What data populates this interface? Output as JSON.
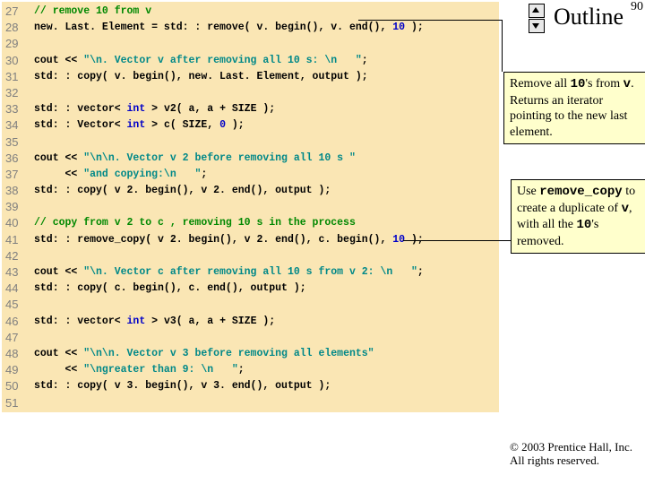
{
  "page_number": "90",
  "outline_label": "Outline",
  "line_start": 27,
  "line_end": 51,
  "code_lines": [
    {
      "n": 27,
      "seg": [
        {
          "c": "cm",
          "t": "// remove 10 from v"
        }
      ]
    },
    {
      "n": 28,
      "seg": [
        {
          "t": "new. Last. Element = std: : remove( v. begin(), v. end(), "
        },
        {
          "c": "kw",
          "t": "10"
        },
        {
          "t": " );"
        }
      ]
    },
    {
      "n": 29,
      "seg": []
    },
    {
      "n": 30,
      "seg": [
        {
          "t": "cout << "
        },
        {
          "c": "str",
          "t": "\"\\n. Vector v after removing all 10 s: \\n   \""
        },
        {
          "t": ";"
        }
      ]
    },
    {
      "n": 31,
      "seg": [
        {
          "t": "std: : copy( v. begin(), new. Last. Element, output );"
        }
      ]
    },
    {
      "n": 32,
      "seg": []
    },
    {
      "n": 33,
      "seg": [
        {
          "t": "std: : vector< "
        },
        {
          "c": "kw",
          "t": "int"
        },
        {
          "t": " > v2( a, a + SIZE );"
        }
      ]
    },
    {
      "n": 34,
      "seg": [
        {
          "t": "std: : Vector< "
        },
        {
          "c": "kw",
          "t": "int"
        },
        {
          "t": " > c( SIZE, "
        },
        {
          "c": "kw",
          "t": "0"
        },
        {
          "t": " );"
        }
      ]
    },
    {
      "n": 35,
      "seg": []
    },
    {
      "n": 36,
      "seg": [
        {
          "t": "cout << "
        },
        {
          "c": "str",
          "t": "\"\\n\\n. Vector v 2 before removing all 10 s \""
        }
      ]
    },
    {
      "n": 37,
      "seg": [
        {
          "t": "     << "
        },
        {
          "c": "str",
          "t": "\"and copying:\\n   \""
        },
        {
          "t": ";"
        }
      ]
    },
    {
      "n": 38,
      "seg": [
        {
          "t": "std: : copy( v 2. begin(), v 2. end(), output );"
        }
      ]
    },
    {
      "n": 39,
      "seg": []
    },
    {
      "n": 40,
      "seg": [
        {
          "c": "cm",
          "t": "// copy from v 2 to c , removing 10 s in the process"
        }
      ]
    },
    {
      "n": 41,
      "seg": [
        {
          "t": "std: : remove_copy( v 2. begin(), v 2. end(), c. begin(), "
        },
        {
          "c": "kw",
          "t": "10"
        },
        {
          "t": " );"
        }
      ]
    },
    {
      "n": 42,
      "seg": []
    },
    {
      "n": 43,
      "seg": [
        {
          "t": "cout << "
        },
        {
          "c": "str",
          "t": "\"\\n. Vector c after removing all 10 s from v 2: \\n   \""
        },
        {
          "t": ";"
        }
      ]
    },
    {
      "n": 44,
      "seg": [
        {
          "t": "std: : copy( c. begin(), c. end(), output );"
        }
      ]
    },
    {
      "n": 45,
      "seg": []
    },
    {
      "n": 46,
      "seg": [
        {
          "t": "std: : vector< "
        },
        {
          "c": "kw",
          "t": "int"
        },
        {
          "t": " > v3( a, a + SIZE );"
        }
      ]
    },
    {
      "n": 47,
      "seg": []
    },
    {
      "n": 48,
      "seg": [
        {
          "t": "cout << "
        },
        {
          "c": "str",
          "t": "\"\\n\\n. Vector v 3 before removing all elements\""
        }
      ]
    },
    {
      "n": 49,
      "seg": [
        {
          "t": "     << "
        },
        {
          "c": "str",
          "t": "\"\\ngreater than 9: \\n   \""
        },
        {
          "t": ";"
        }
      ]
    },
    {
      "n": 50,
      "seg": [
        {
          "t": "std: : copy( v 3. begin(), v 3. end(), output );"
        }
      ]
    },
    {
      "n": 51,
      "seg": []
    }
  ],
  "callout1": {
    "pre": "Remove all ",
    "mono": "10",
    "mid": "'s from ",
    "mono2": "v",
    "rest": ". Returns an iterator pointing to the new last element."
  },
  "callout2": {
    "pre": "Use ",
    "mono": "remove_copy",
    "mid": " to create a duplicate of ",
    "mono2": "v",
    "rest": ", with all the ",
    "mono3": "10",
    "tail": "'s removed."
  },
  "footer_line1": "© 2003 Prentice Hall, Inc.",
  "footer_line2": "All rights reserved."
}
